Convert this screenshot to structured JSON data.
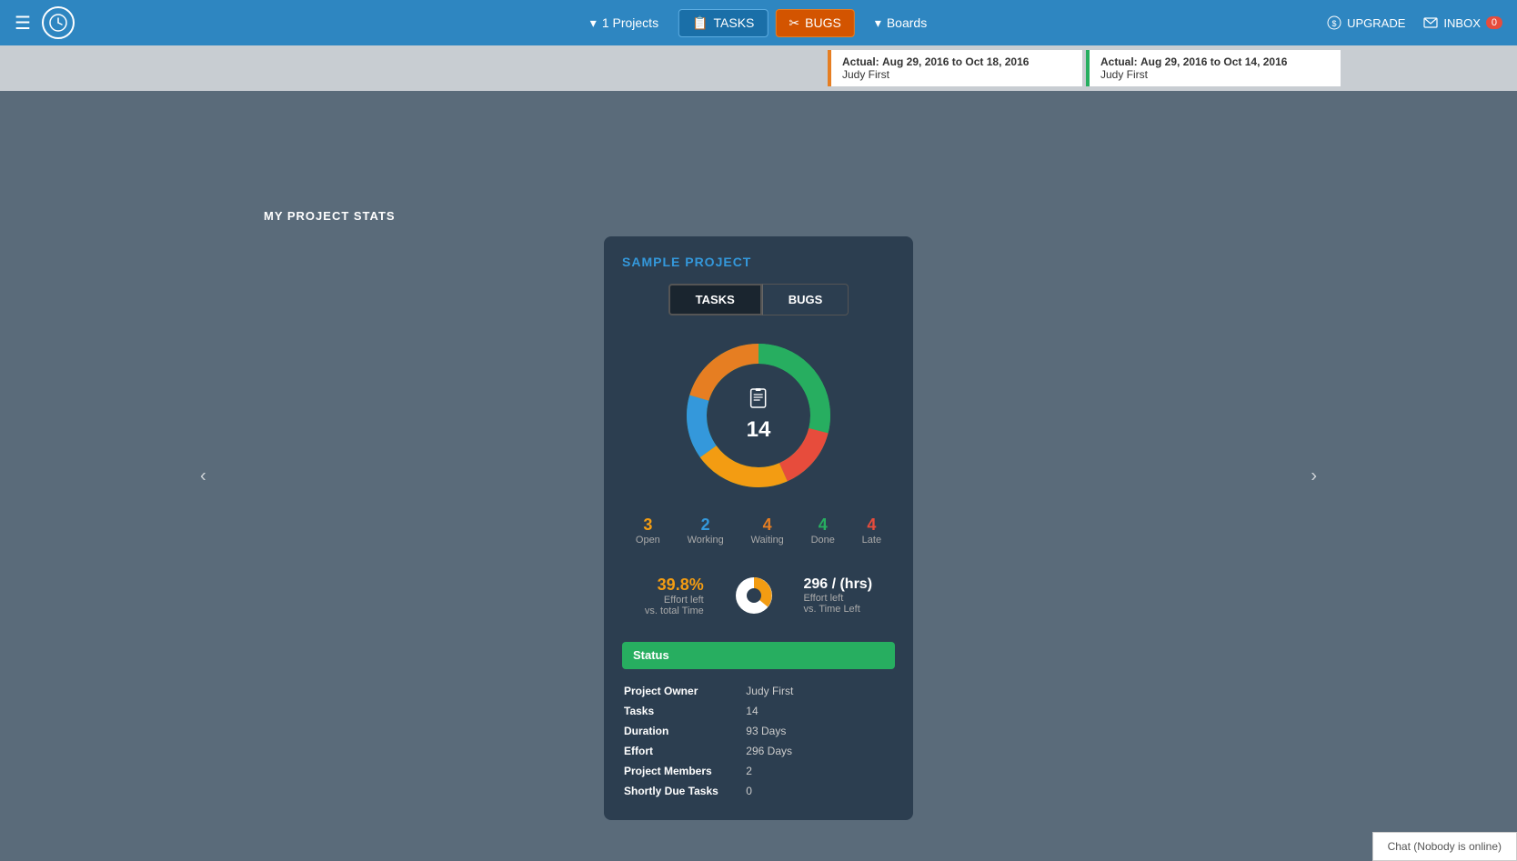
{
  "header": {
    "hamburger_label": "☰",
    "clock_symbol": "🕐",
    "nav": {
      "projects_label": "1 Projects",
      "tasks_label": "TASKS",
      "bugs_label": "BUGS",
      "boards_label": "Boards"
    },
    "upgrade_label": "UPGRADE",
    "inbox_label": "INBOX",
    "inbox_count": "0"
  },
  "sub_header": {
    "card1": {
      "actual_label": "Actual:",
      "actual_date": "Aug 29, 2016 to Oct 18, 2016",
      "user": "Judy First"
    },
    "card2": {
      "actual_label": "Actual:",
      "actual_date": "Aug 29, 2016 to Oct 14, 2016",
      "user": "Judy First"
    }
  },
  "page": {
    "stats_heading": "MY PROJECT STATS"
  },
  "project_card": {
    "title": "SAMPLE PROJECT",
    "toggle": {
      "tasks_label": "TASKS",
      "bugs_label": "BUGS"
    },
    "chart": {
      "total": "14",
      "segments": {
        "open": {
          "count": 3,
          "color": "#f39c12",
          "pct": 21
        },
        "working": {
          "count": 2,
          "color": "#3498db",
          "pct": 14
        },
        "waiting": {
          "count": 4,
          "color": "#e67e22",
          "pct": 29
        },
        "done": {
          "count": 4,
          "color": "#27ae60",
          "pct": 29
        },
        "late": {
          "count": 4,
          "color": "#e74c3c",
          "pct": 7
        }
      }
    },
    "stats": {
      "open": {
        "count": "3",
        "label": "Open"
      },
      "working": {
        "count": "2",
        "label": "Working"
      },
      "waiting": {
        "count": "4",
        "label": "Waiting"
      },
      "done": {
        "count": "4",
        "label": "Done"
      },
      "late": {
        "count": "4",
        "label": "Late"
      }
    },
    "effort": {
      "pct": "39.8%",
      "pct_label1": "Effort left",
      "pct_label2": "vs. total Time",
      "hrs": "296 / (hrs)",
      "hrs_label1": "Effort left",
      "hrs_label2": "vs. Time Left"
    },
    "status_label": "Status",
    "details": {
      "project_owner_label": "Project Owner",
      "project_owner_val": "Judy First",
      "tasks_label": "Tasks",
      "tasks_val": "14",
      "duration_label": "Duration",
      "duration_val": "93 Days",
      "effort_label": "Effort",
      "effort_val": "296 Days",
      "members_label": "Project Members",
      "members_val": "2",
      "shortly_due_label": "Shortly Due Tasks",
      "shortly_due_val": "0"
    }
  },
  "chat": {
    "label": "Chat (Nobody is online)"
  }
}
